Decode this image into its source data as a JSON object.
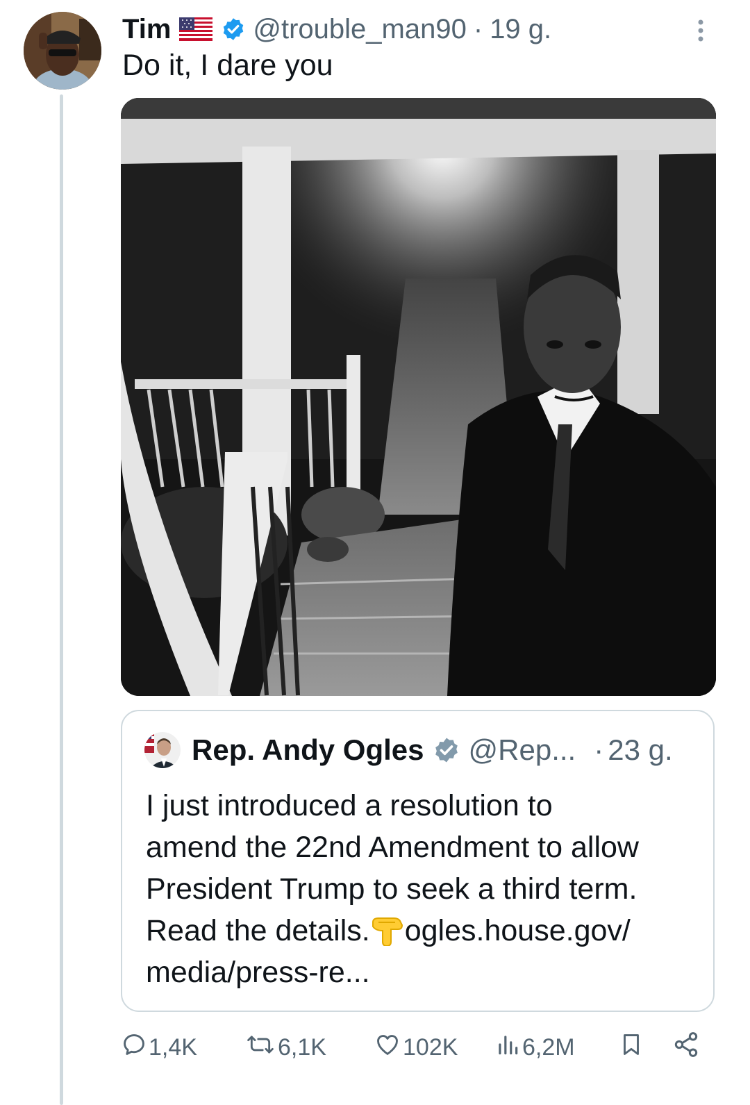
{
  "post": {
    "author_name": "Tim",
    "handle": "@trouble_man90",
    "separator": "·",
    "time": "19 g.",
    "text": "Do it, I dare you"
  },
  "quote": {
    "author_name": "Rep. Andy Ogles",
    "handle": "@Rep...",
    "separator": "·",
    "time": "23 g.",
    "text_lines": [
      "I just introduced a resolution to",
      "amend the 22nd Amendment to allow",
      "President Trump to seek a third term.",
      "Read the details.",
      "ogles.house.gov/",
      "media/press-re..."
    ]
  },
  "actions": {
    "replies": "1,4K",
    "reposts": "6,1K",
    "likes": "102K",
    "views": "6,2M"
  },
  "icons": {
    "verified": "verified-badge-icon",
    "flag": "us-flag-icon",
    "more": "more-vertical-icon",
    "reply": "reply-icon",
    "repost": "repost-icon",
    "like": "heart-icon",
    "views": "views-chart-icon",
    "bookmark": "bookmark-icon",
    "share": "share-icon",
    "pointing": "backhand-pointing-down-emoji"
  },
  "colors": {
    "verified": "#1d9bf0",
    "quote_verified": "#829aab",
    "secondary_text": "#536471",
    "primary_text": "#0f1419",
    "border": "#cfd9de"
  }
}
